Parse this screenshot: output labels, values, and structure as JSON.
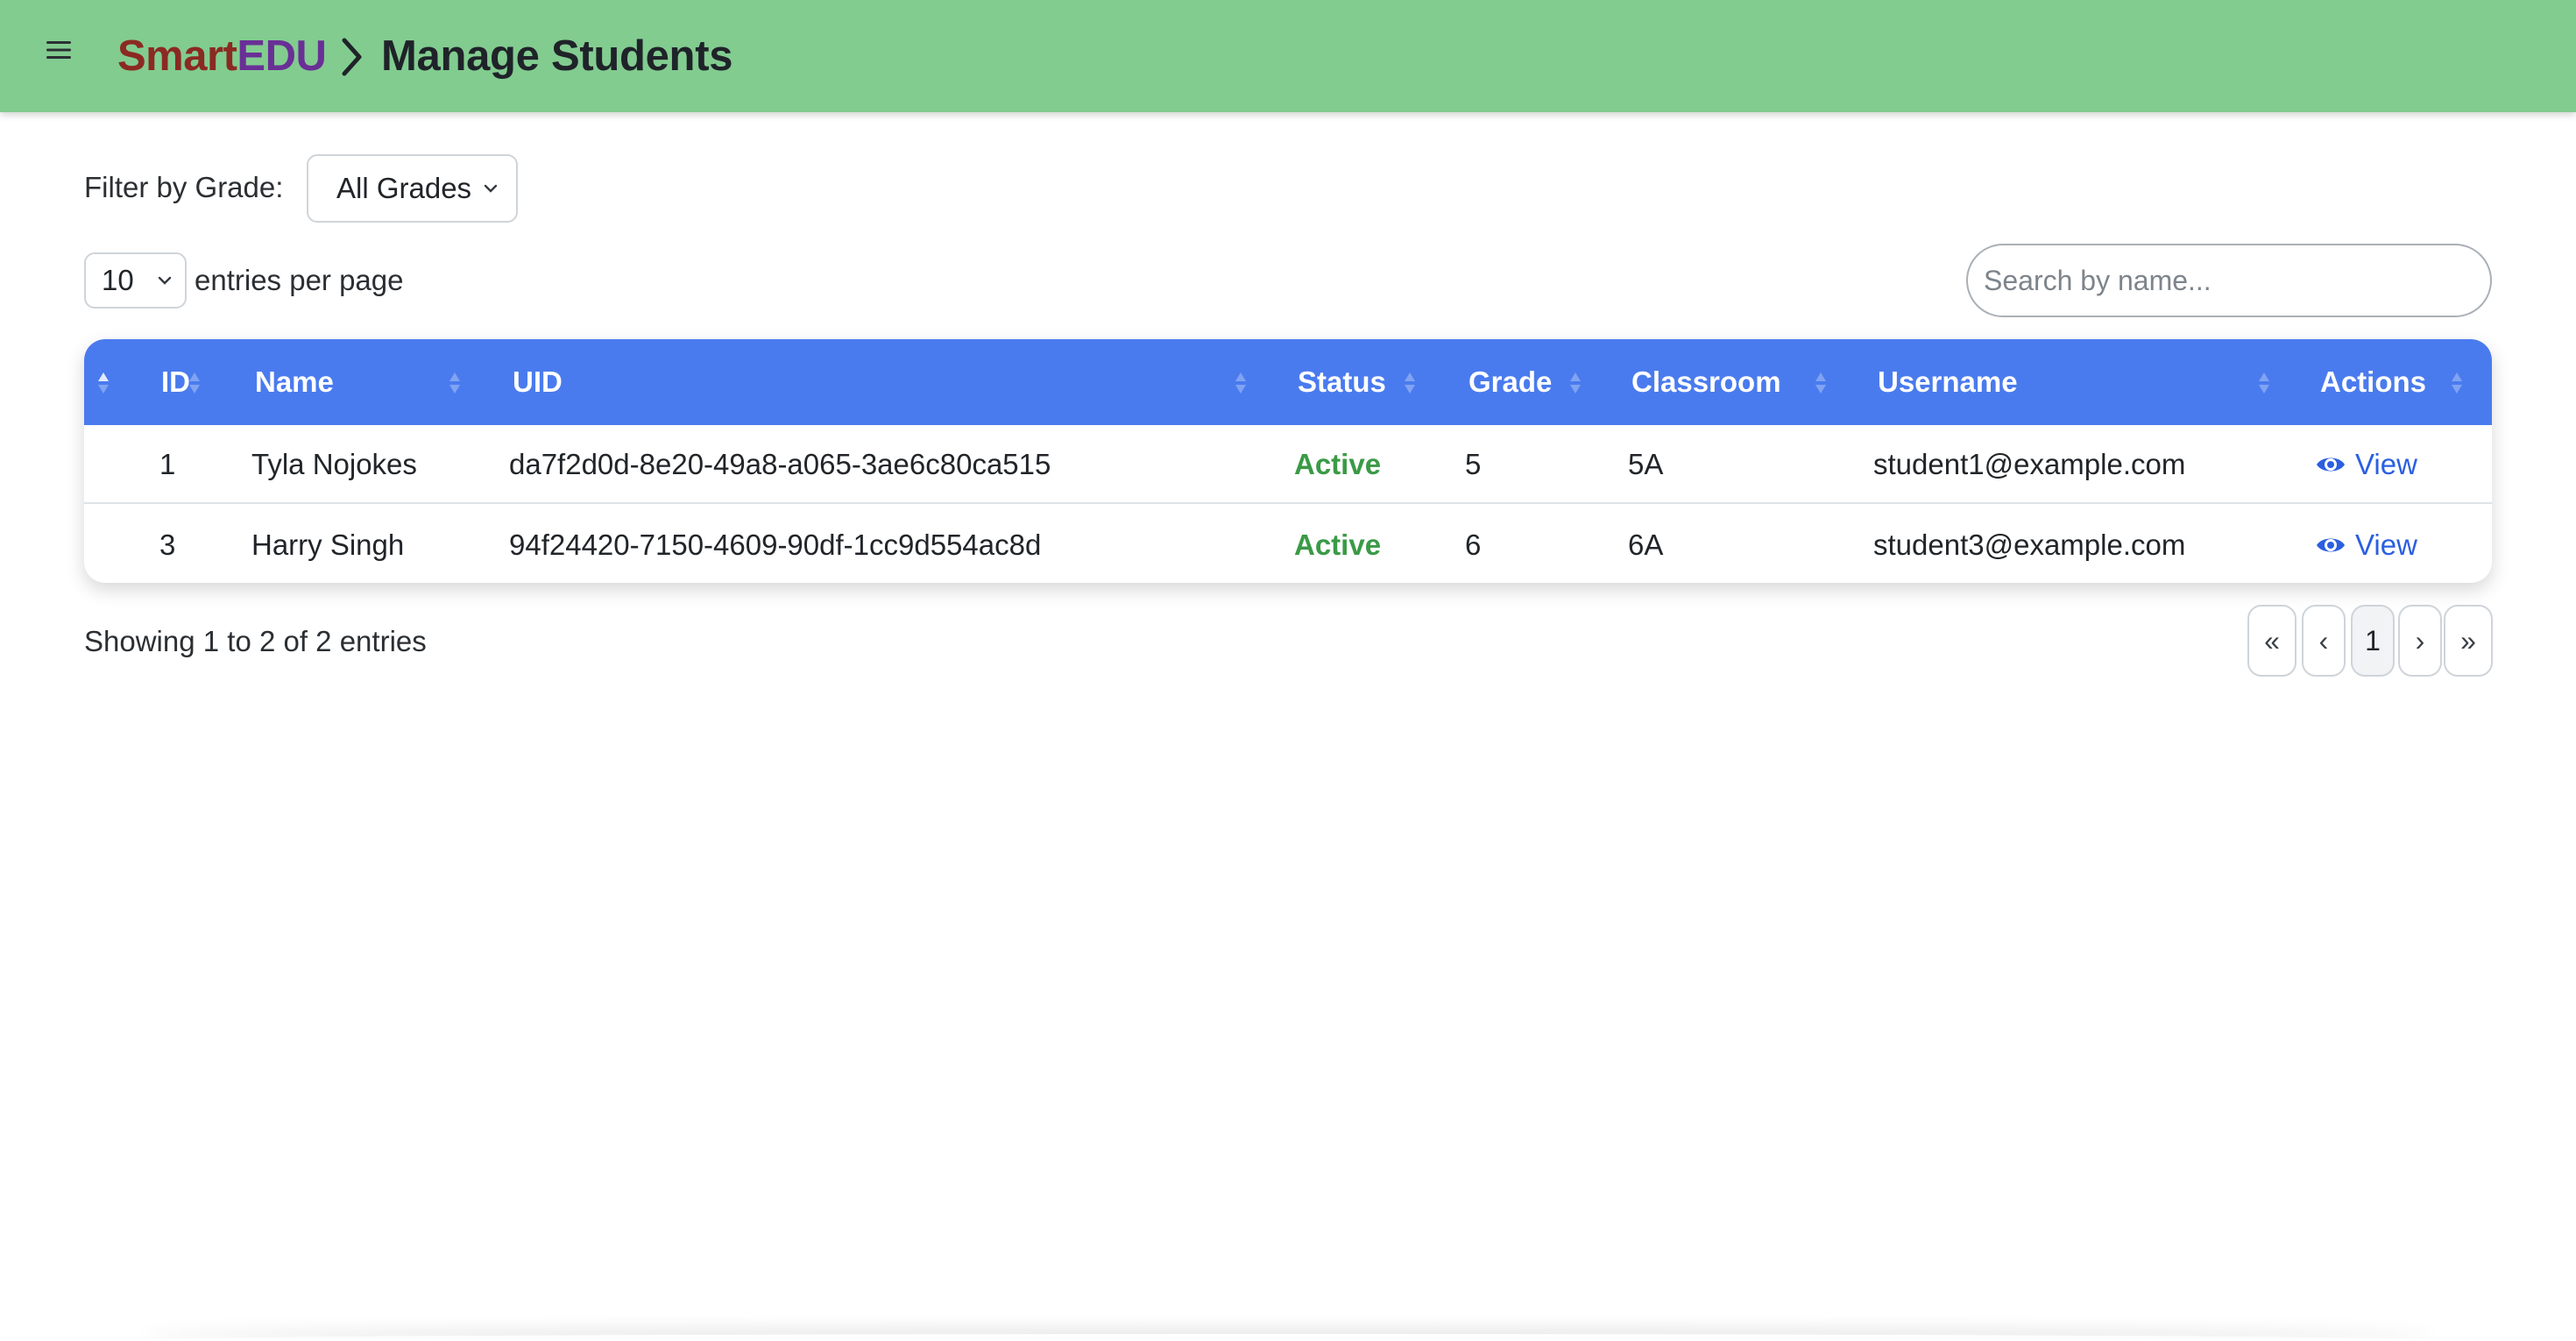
{
  "header": {
    "brand_part1": "Smart",
    "brand_part2": "EDU",
    "page_title": "Manage Students",
    "bar_color": "#82cc90",
    "icons": {
      "menu": "hamburger-menu-icon",
      "separator": "chevron-right-icon"
    }
  },
  "filter": {
    "label": "Filter by Grade:",
    "selected": "All Grades"
  },
  "entries": {
    "selected": "10",
    "label": "entries per page"
  },
  "search": {
    "placeholder": "Search by name..."
  },
  "table": {
    "header_color": "#4a7bee",
    "columns": [
      "ID",
      "Name",
      "UID",
      "Status",
      "Grade",
      "Classroom",
      "Username",
      "Actions"
    ],
    "rows": [
      {
        "id": "1",
        "name": "Tyla Nojokes",
        "uid": "da7f2d0d-8e20-49a8-a065-3ae6c80ca515",
        "status": "Active",
        "grade": "5",
        "classroom": "5A",
        "username": "student1@example.com",
        "action": "View"
      },
      {
        "id": "3",
        "name": "Harry Singh",
        "uid": "94f24420-7150-4609-90df-1cc9d554ac8d",
        "status": "Active",
        "grade": "6",
        "classroom": "6A",
        "username": "student3@example.com",
        "action": "View"
      }
    ],
    "status_color": "#3a9a46",
    "link_color": "#2b5fe0"
  },
  "footer": {
    "showing": "Showing 1 to 2 of 2 entries",
    "pagination": {
      "first": "«",
      "prev": "‹",
      "current": "1",
      "next": "›",
      "last": "»"
    }
  }
}
